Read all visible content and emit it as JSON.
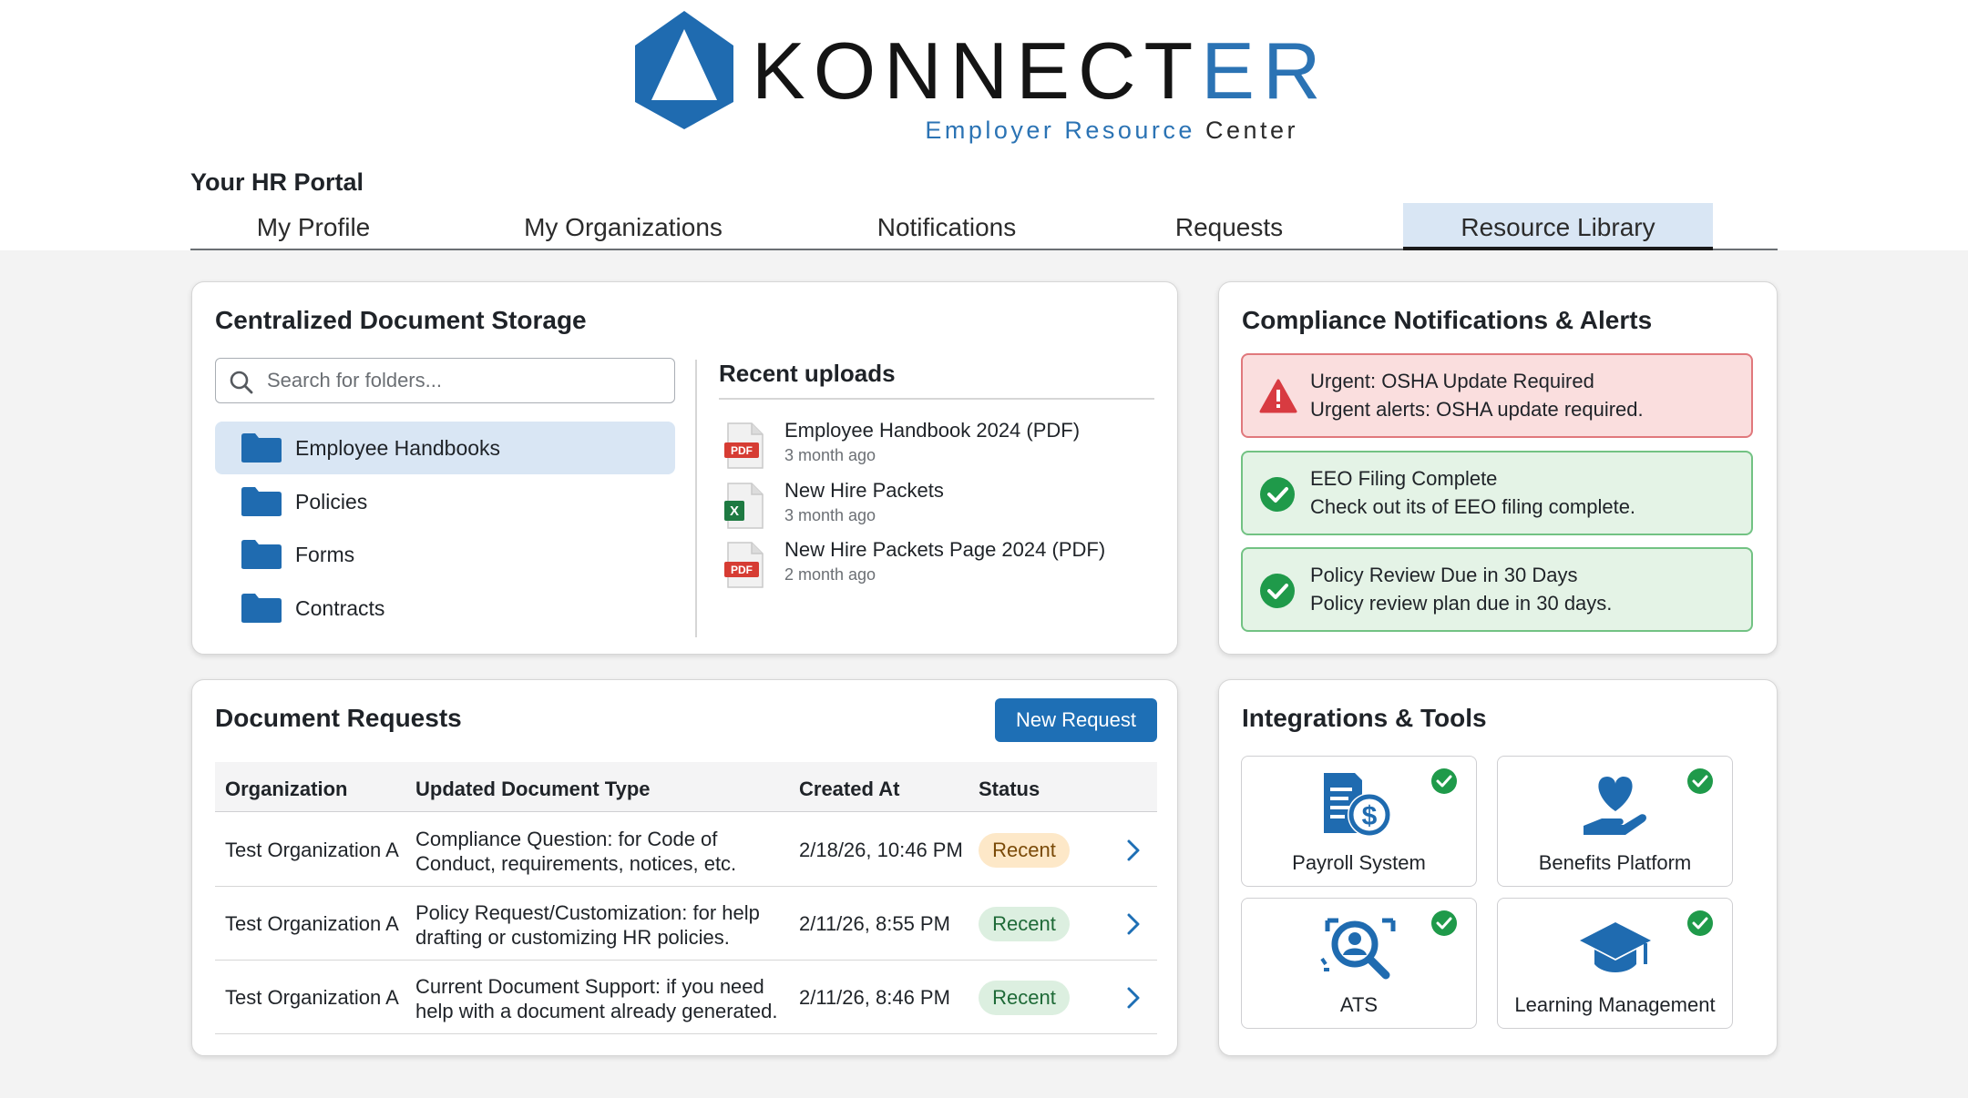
{
  "brand": {
    "name_main": "KONNECT",
    "name_accent": "ER",
    "subtitle_accent": "Employer Resource",
    "subtitle_dark": "Center",
    "accent_color": "#2b73b4"
  },
  "portal": {
    "title": "Your HR Portal",
    "tabs": [
      {
        "label": "My Profile",
        "active": false
      },
      {
        "label": "My Organizations",
        "active": false
      },
      {
        "label": "Notifications",
        "active": false
      },
      {
        "label": "Requests",
        "active": false
      },
      {
        "label": "Resource Library",
        "active": true
      }
    ]
  },
  "storage": {
    "title": "Centralized Document Storage",
    "search_placeholder": "Search for folders...",
    "folders": [
      {
        "label": "Employee Handbooks",
        "selected": true,
        "icon": "folder-icon"
      },
      {
        "label": "Policies",
        "selected": false,
        "icon": "folder-icon"
      },
      {
        "label": "Forms",
        "selected": false,
        "icon": "folder-icon"
      },
      {
        "label": "Contracts",
        "selected": false,
        "icon": "folder-icon"
      }
    ],
    "uploads_title": "Recent uploads",
    "uploads": [
      {
        "name": "Employee Handbook 2024 (PDF)",
        "time": "3 month ago",
        "icon": "pdf-file-icon",
        "badge": "PDF"
      },
      {
        "name": "New Hire Packets",
        "time": "3 month ago",
        "icon": "excel-file-icon",
        "badge": "X"
      },
      {
        "name": "New Hire Packets Page 2024 (PDF)",
        "time": "2 month ago",
        "icon": "pdf-file-icon",
        "badge": "PDF"
      }
    ]
  },
  "compliance": {
    "title": "Compliance Notifications & Alerts",
    "alerts": [
      {
        "title": "Urgent: OSHA Update Required",
        "body": "Urgent alerts: OSHA update required.",
        "level": "urgent",
        "icon": "warning-icon",
        "color": "#d83b41"
      },
      {
        "title": "EEO Filing Complete",
        "body": "Check out its of EEO filing complete.",
        "level": "success",
        "icon": "check-circle-icon",
        "color": "#1f9a4a"
      },
      {
        "title": "Policy Review Due in 30 Days",
        "body": "Policy review plan due in 30 days.",
        "level": "success",
        "icon": "check-circle-icon",
        "color": "#1f9a4a"
      }
    ]
  },
  "requests": {
    "title": "Document Requests",
    "new_button": "New Request",
    "columns": [
      "Organization",
      "Updated Document Type",
      "Created At",
      "Status"
    ],
    "rows": [
      {
        "organization": "Test Organization A",
        "type_line1": "Compliance Question: for Code of",
        "type_line2": "Conduct, requirements, notices, etc.",
        "created": "2/18/26, 10:46 PM",
        "status": "Recent",
        "status_style": "orange"
      },
      {
        "organization": "Test Organization A",
        "type_line1": "Policy Request/Customization: for help",
        "type_line2": "drafting or customizing HR policies.",
        "created": "2/11/26, 8:55 PM",
        "status": "Recent",
        "status_style": "green"
      },
      {
        "organization": "Test Organization A",
        "type_line1": "Current Document Support: if you need",
        "type_line2": "help with a document already generated.",
        "created": "2/11/26, 8:46 PM",
        "status": "Recent",
        "status_style": "green"
      }
    ]
  },
  "integrations": {
    "title": "Integrations & Tools",
    "tools": [
      {
        "label": "Payroll System",
        "icon": "payroll-icon",
        "connected": true
      },
      {
        "label": "Benefits Platform",
        "icon": "benefits-heart-hand-icon",
        "connected": true
      },
      {
        "label": "ATS",
        "icon": "ats-search-icon",
        "connected": true
      },
      {
        "label": "Learning Management",
        "icon": "graduation-cap-icon",
        "connected": true
      }
    ]
  }
}
